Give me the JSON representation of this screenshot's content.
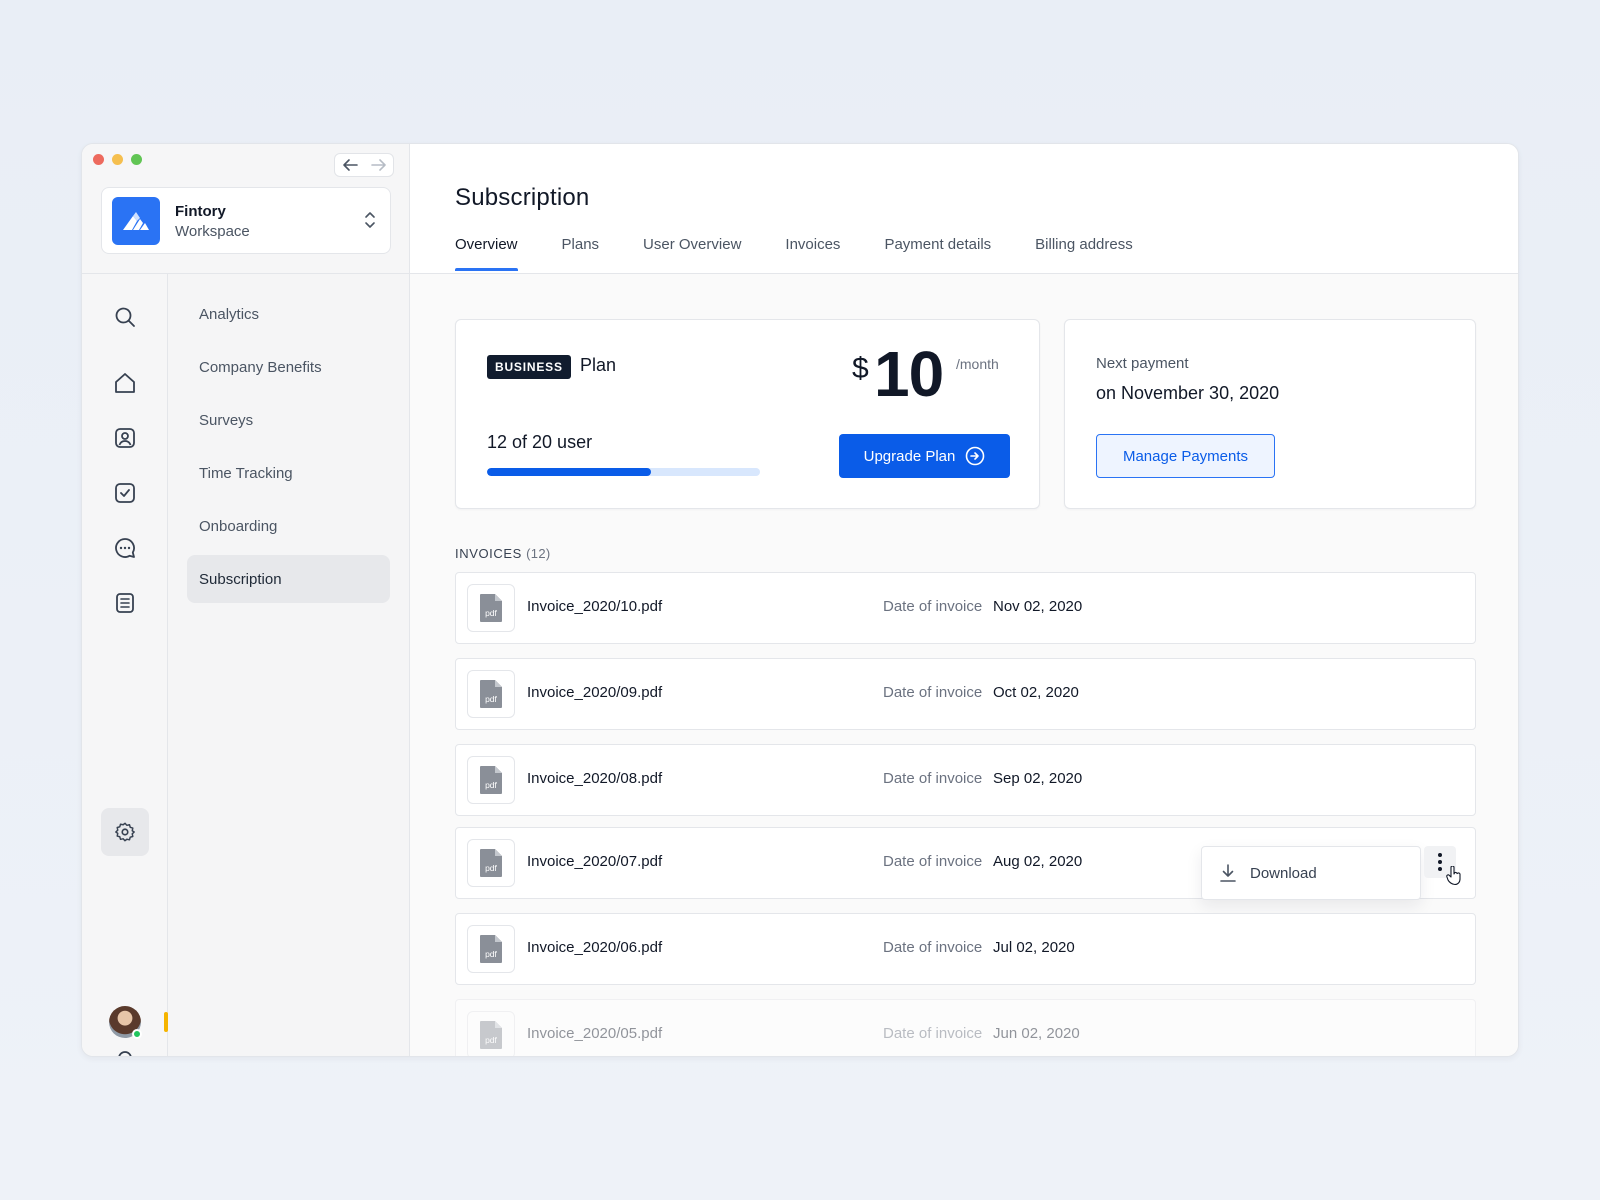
{
  "window": {
    "controls": [
      "close",
      "minimize",
      "maximize"
    ],
    "nav_icons": [
      "arrow-left-icon",
      "arrow-right-icon"
    ]
  },
  "workspace": {
    "name": "Fintory",
    "subtitle": "Workspace",
    "logo_icon": "fintory-logo-icon",
    "switch_icon": "chevron-up-down-icon",
    "brand_color": "#2a73f4"
  },
  "rail": {
    "icons": [
      "search-icon",
      "home-icon",
      "contacts-icon",
      "tasks-icon",
      "chat-icon",
      "document-icon",
      "settings-icon",
      "bell-icon"
    ],
    "active": "settings-icon",
    "status_color": "#22c55e"
  },
  "subnav": {
    "items": [
      {
        "label": "Analytics"
      },
      {
        "label": "Company Benefits"
      },
      {
        "label": "Surveys"
      },
      {
        "label": "Time Tracking"
      },
      {
        "label": "Onboarding"
      },
      {
        "label": "Subscription"
      }
    ],
    "active_index": 5
  },
  "header": {
    "title": "Subscription",
    "tabs": [
      {
        "label": "Overview"
      },
      {
        "label": "Plans"
      },
      {
        "label": "User Overview"
      },
      {
        "label": "Invoices"
      },
      {
        "label": "Payment details"
      },
      {
        "label": "Billing address"
      }
    ],
    "active_tab_index": 0
  },
  "plan": {
    "badge": "BUSINESS",
    "label": "Plan",
    "currency": "$",
    "price": "10",
    "period": "/month",
    "users_text": "12 of 20 user",
    "users_used": 12,
    "users_total": 20,
    "upgrade_label": "Upgrade Plan",
    "upgrade_icon": "arrow-right-circle-icon"
  },
  "payment": {
    "label": "Next payment",
    "date": "on November 30, 2020",
    "manage_label": "Manage Payments"
  },
  "invoices": {
    "heading": "INVOICES",
    "count": "(12)",
    "date_label": "Date of invoice",
    "file_icon": "pdf-file-icon",
    "rows": [
      {
        "name": "Invoice_2020/10.pdf",
        "date": "Nov 02, 2020"
      },
      {
        "name": "Invoice_2020/09.pdf",
        "date": "Oct 02, 2020"
      },
      {
        "name": "Invoice_2020/08.pdf",
        "date": "Sep 02, 2020"
      },
      {
        "name": "Invoice_2020/07.pdf",
        "date": "Aug 02, 2020"
      },
      {
        "name": "Invoice_2020/06.pdf",
        "date": "Jul 02, 2020"
      },
      {
        "name": "Invoice_2020/05.pdf",
        "date": "Jun 02, 2020"
      }
    ],
    "menu": {
      "row_index": 3,
      "download_label": "Download",
      "download_icon": "download-icon",
      "more_icon": "more-vertical-icon"
    }
  },
  "colors": {
    "accent": "#0a5ce8",
    "badge_bg": "#111c2e",
    "progress_track": "#d8e7fd"
  }
}
